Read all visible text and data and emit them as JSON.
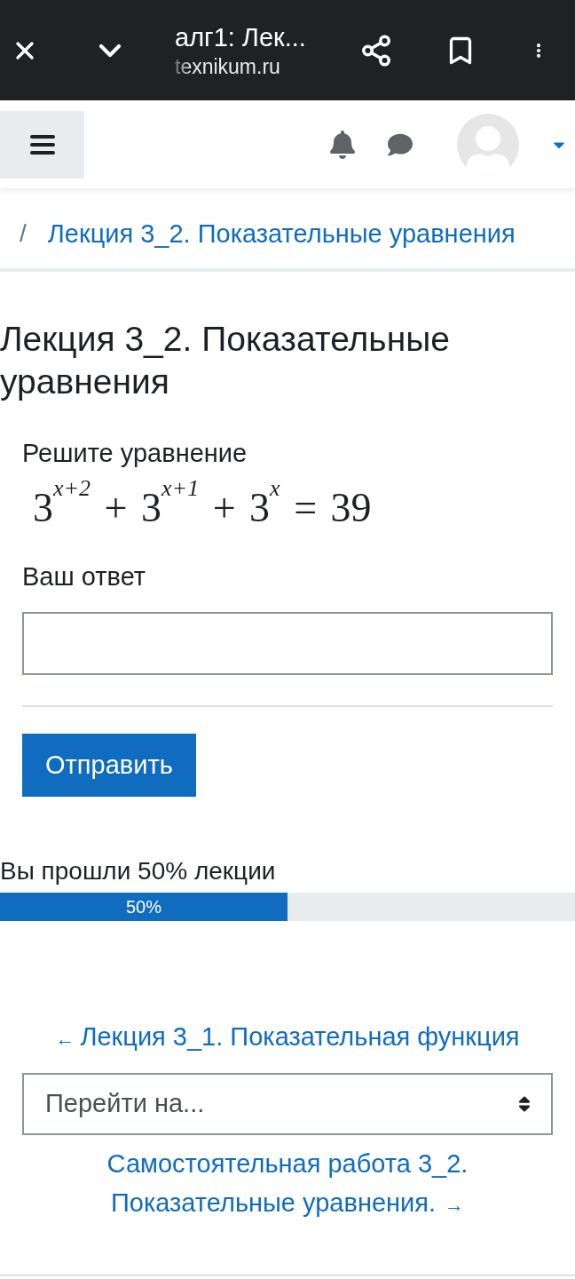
{
  "browser_bar": {
    "title": "алг1: Лек...",
    "url": "texnikum.ru"
  },
  "breadcrumb": {
    "separator": "/",
    "link": "Лекция 3_2. Показательные уравнения"
  },
  "heading": "Лекция 3_2. Показательные уравнения",
  "question": {
    "prompt": "Решите уравнение",
    "equation": "3$^{x+2}$ + 3$^{x+1}$ + 3$^{x}$ = 39",
    "answer_label": "Ваш ответ"
  },
  "submit_button": "Отправить",
  "progress": {
    "label": "Вы прошли 50% лекции",
    "level": 0.5,
    "reading": "50%"
  },
  "navigation": {
    "previous": {
      "arrow": "←",
      "label": "Лекция 3_1. Показательная функция"
    },
    "jump_select": {
      "placeholder": "Перейти на..."
    },
    "next": {
      "label": "Самостоятельная работа 3_2. Показательные уравнения.",
      "arrow": "→"
    }
  }
}
